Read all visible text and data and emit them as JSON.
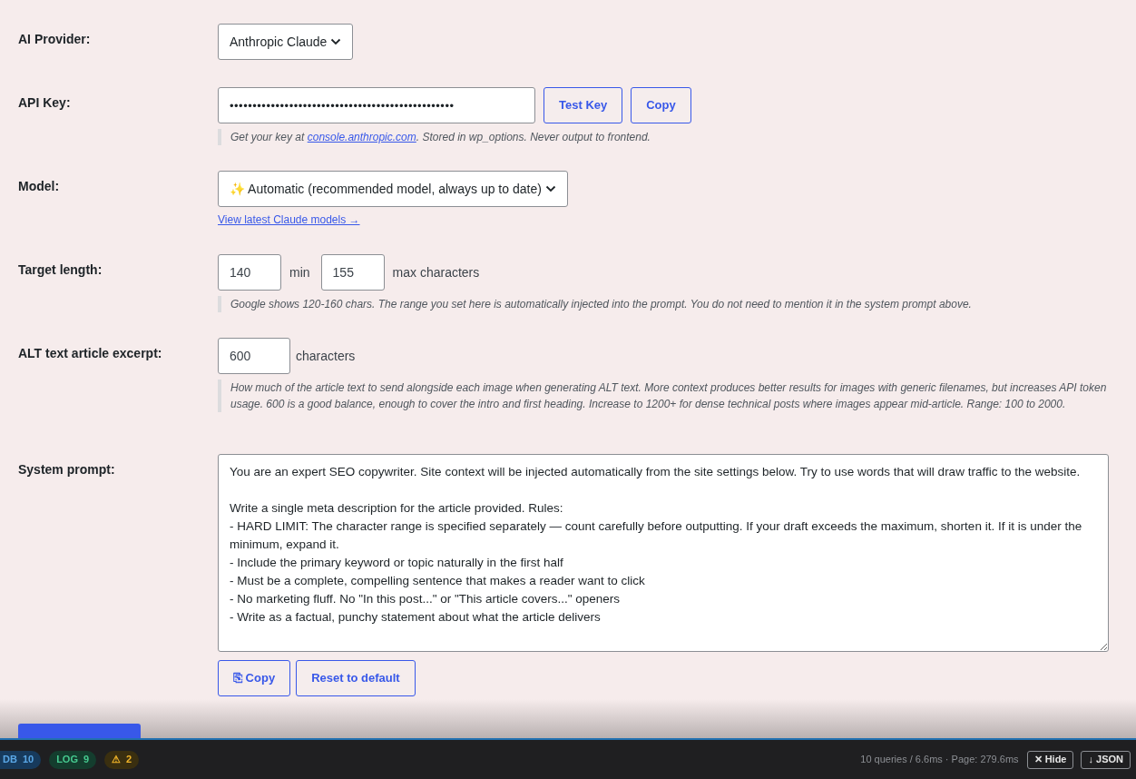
{
  "fields": [
    {
      "kind": "select",
      "label": "AI Provider:",
      "value": "Anthropic Claude"
    },
    {
      "kind": "key",
      "label": "API Key:",
      "value": "•••••••••••••••••••••••••••••••••••••••••••••••••",
      "buttons": [
        "Test Key",
        "Copy"
      ],
      "help_before": "Get your key at ",
      "help_link": "console.anthropic.com",
      "help_after": ". Stored in wp_options. Never output to frontend."
    },
    {
      "kind": "model",
      "label": "Model:",
      "value": "✨ Automatic (recommended model, always up to date)",
      "link": "View latest Claude models →"
    },
    {
      "kind": "range",
      "label": "Target length:",
      "min": "140",
      "min_unit": "min",
      "max": "155",
      "max_unit": "max characters",
      "help": "Google shows 120-160 chars. The range you set here is automatically injected into the prompt. You do not need to mention it in the system prompt above."
    },
    {
      "kind": "number",
      "label": "ALT text article excerpt:",
      "value": "600",
      "unit": "characters",
      "help": "How much of the article text to send alongside each image when generating ALT text. More context produces better results for images with generic filenames, but increases API token usage. 600 is a good balance, enough to cover the intro and first heading. Increase to 1200+ for dense technical posts where images appear mid-article. Range: 100 to 2000."
    },
    {
      "kind": "prompt",
      "label": "System prompt:",
      "value": "You are an expert SEO copywriter. Site context will be injected automatically from the site settings below. Try to use words that will draw traffic to the website.\n\nWrite a single meta description for the article provided. Rules:\n- HARD LIMIT: The character range is specified separately — count carefully before outputting. If your draft exceeds the maximum, shorten it. If it is under the minimum, expand it.\n- Include the primary keyword or topic naturally in the first half\n- Must be a complete, compelling sentence that makes a reader want to click\n- No marketing fluff. No \"In this post...\" or \"This article covers...\" openers\n- Write as a factual, punchy statement about what the article delivers",
      "buttons": [
        "⎘ Copy",
        "Reset to default"
      ]
    }
  ],
  "debug_bar": {
    "badges": [
      {
        "kind": "db",
        "label": "DB",
        "count": "10"
      },
      {
        "kind": "log",
        "label": "LOG",
        "count": "9"
      },
      {
        "kind": "warn",
        "label": "⚠",
        "count": "2"
      }
    ],
    "stats": "10 queries / 6.6ms · Page: 279.6ms",
    "buttons": [
      "✕ Hide",
      "↓ JSON"
    ]
  }
}
